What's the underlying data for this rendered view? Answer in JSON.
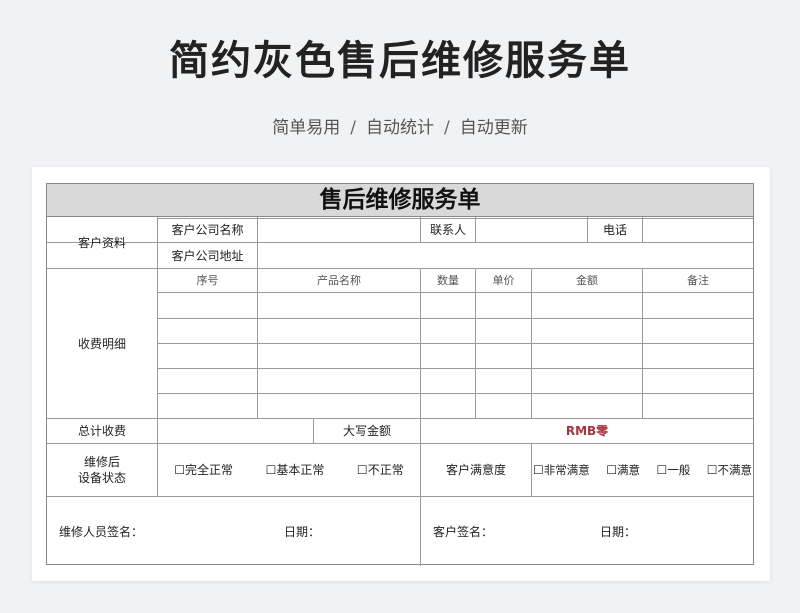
{
  "banner": {
    "title": "简约灰色售后维修服务单",
    "subtitle_items": [
      "简单易用",
      "自动统计",
      "自动更新"
    ],
    "separator": "/"
  },
  "form": {
    "title": "售后维修服务单",
    "customer": {
      "section_label": "客户资料",
      "company_name_label": "客户公司名称",
      "company_name_value": "",
      "contact_label": "联系人",
      "contact_value": "",
      "phone_label": "电话",
      "phone_value": "",
      "address_label": "客户公司地址",
      "address_value": ""
    },
    "charges": {
      "section_label": "收费明细",
      "columns": [
        "序号",
        "产品名称",
        "数量",
        "单价",
        "金额",
        "备注"
      ],
      "rows": [
        [
          "",
          "",
          "",
          "",
          "",
          ""
        ],
        [
          "",
          "",
          "",
          "",
          "",
          ""
        ],
        [
          "",
          "",
          "",
          "",
          "",
          ""
        ],
        [
          "",
          "",
          "",
          "",
          "",
          ""
        ],
        [
          "",
          "",
          "",
          "",
          "",
          ""
        ]
      ]
    },
    "totals": {
      "total_label": "总计收费",
      "total_value": "",
      "uppercase_label": "大写金额",
      "uppercase_value": "RMB零"
    },
    "status": {
      "label_line1": "维修后",
      "label_line2": "设备状态",
      "options": [
        "完全正常",
        "基本正常",
        "不正常"
      ],
      "satisfaction_label": "客户满意度",
      "satisfaction_options": [
        "非常满意",
        "满意",
        "一般",
        "不满意"
      ],
      "checkbox_glyph": "☐"
    },
    "signatures": {
      "technician_label": "维修人员签名：",
      "date_label_1": "日期：",
      "customer_label": "客户签名：",
      "date_label_2": "日期："
    }
  }
}
